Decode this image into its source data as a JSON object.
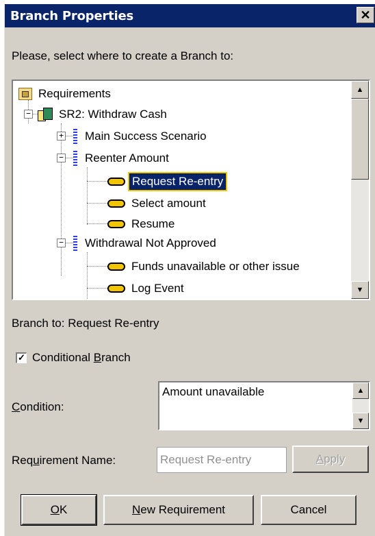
{
  "window": {
    "title": "Branch Properties",
    "close_label": "✕"
  },
  "prompt": "Please, select where to create a Branch to:",
  "tree": {
    "nodes": [
      {
        "label": "Requirements",
        "icon": "folder-icon"
      },
      {
        "label": "SR2: Withdraw Cash",
        "icon": "requirement-icon",
        "expander": "−"
      },
      {
        "label": "Main Success Scenario",
        "icon": "scenario-icon",
        "expander": "+"
      },
      {
        "label": "Reenter Amount",
        "icon": "scenario-icon",
        "expander": "−"
      },
      {
        "label": "Request Re-entry",
        "icon": "step-icon",
        "selected": true
      },
      {
        "label": "Select amount",
        "icon": "step-icon"
      },
      {
        "label": "Resume",
        "icon": "step-icon"
      },
      {
        "label": "Withdrawal Not Approved",
        "icon": "scenario-icon",
        "expander": "−"
      },
      {
        "label": "Funds unavailable or other issue",
        "icon": "step-icon"
      },
      {
        "label": "Log Event",
        "icon": "step-icon"
      }
    ]
  },
  "branch_to": "Branch to: Request Re-entry",
  "conditional": {
    "label_pre": "Conditional ",
    "label_u": "B",
    "label_post": "ranch",
    "checked": true,
    "check_glyph": "✓"
  },
  "condition": {
    "label_u": "C",
    "label_post": "ondition:",
    "value": "Amount unavailable"
  },
  "requirement_name": {
    "label_pre": "Req",
    "label_u": "u",
    "label_post": "irement Name:",
    "value": "Request Re-entry"
  },
  "buttons": {
    "apply": {
      "u": "A",
      "rest": "pply"
    },
    "ok": {
      "u": "O",
      "rest": "K"
    },
    "new_req": {
      "u": "N",
      "rest": "ew Requirement"
    },
    "cancel": "Cancel"
  },
  "scroll_arrows": {
    "up": "▲",
    "down": "▼"
  }
}
